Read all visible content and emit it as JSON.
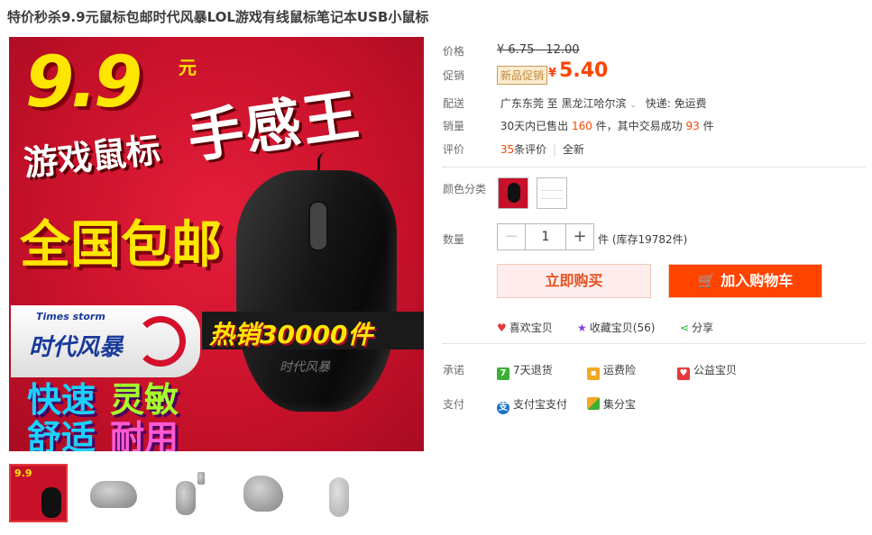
{
  "title": "特价秒杀9.9元鼠标包邮时代风暴LOL游戏有线鼠标笔记本USB小鼠标",
  "main_image": {
    "price_text": "9.9",
    "yuan": "元",
    "headline": "手感王",
    "game_mouse": "游戏鼠标",
    "free_ship": "全国包邮",
    "brand_en": "Times storm",
    "brand_cn": "时代风暴",
    "hot_sale": "热销30000件",
    "features": [
      "快速",
      "灵敏",
      "舒适",
      "耐用"
    ],
    "mouse_brand": "时代风暴"
  },
  "price": {
    "label": "价格",
    "original": "¥ 6.75 - 12.00"
  },
  "promo": {
    "label": "促销",
    "tag": "新品促销",
    "yen": "¥",
    "value": "5.40"
  },
  "delivery": {
    "label": "配送",
    "from": "广东东莞",
    "to_word": "至",
    "to": "黑龙江哈尔滨",
    "express": "快递: 免运费"
  },
  "sales": {
    "label": "销量",
    "prefix": "30天内已售出",
    "sold": "160",
    "middle": "件，其中交易成功",
    "success": "93",
    "suffix": "件"
  },
  "reviews": {
    "label": "评价",
    "count": "35",
    "count_suffix": "条评价",
    "divider": "|",
    "tag": "全新"
  },
  "color": {
    "label": "颜色分类"
  },
  "quantity": {
    "label": "数量",
    "minus": "−",
    "value": "1",
    "plus": "+",
    "stock": "件 (库存19782件)"
  },
  "buttons": {
    "buy_now": "立即购买",
    "add_cart": "加入购物车"
  },
  "actions": {
    "like": "喜欢宝贝",
    "favorite": "收藏宝贝(56)",
    "share": "分享"
  },
  "promise": {
    "label": "承诺",
    "items": [
      "7天退货",
      "运费险",
      "公益宝贝"
    ]
  },
  "payment": {
    "label": "支付",
    "items": [
      "支付宝支付",
      "集分宝"
    ]
  },
  "colors": {
    "accent": "#ff4400",
    "price_red": "#ff4400",
    "buy_bg": "#ffeded"
  }
}
